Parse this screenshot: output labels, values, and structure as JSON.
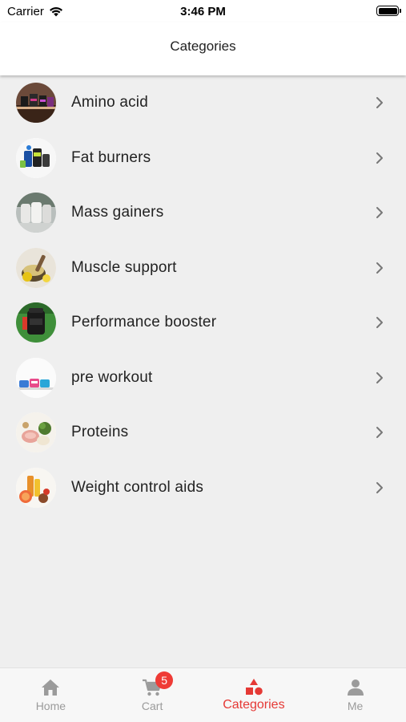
{
  "status_bar": {
    "carrier": "Carrier",
    "time": "3:46 PM"
  },
  "header": {
    "title": "Categories"
  },
  "categories": [
    {
      "label": "Amino acid",
      "thumb_icon": "amino-acid-thumbnail-icon"
    },
    {
      "label": "Fat burners",
      "thumb_icon": "fat-burners-thumbnail-icon"
    },
    {
      "label": "Mass gainers",
      "thumb_icon": "mass-gainers-thumbnail-icon"
    },
    {
      "label": "Muscle support",
      "thumb_icon": "muscle-support-thumbnail-icon"
    },
    {
      "label": "Performance booster",
      "thumb_icon": "performance-booster-thumbnail-icon"
    },
    {
      "label": "pre workout",
      "thumb_icon": "pre-workout-thumbnail-icon"
    },
    {
      "label": "Proteins",
      "thumb_icon": "proteins-thumbnail-icon"
    },
    {
      "label": "Weight control aids",
      "thumb_icon": "weight-control-thumbnail-icon"
    }
  ],
  "tabs": [
    {
      "label": "Home",
      "icon": "home-icon",
      "active": false
    },
    {
      "label": "Cart",
      "icon": "cart-icon",
      "active": false,
      "badge": "5"
    },
    {
      "label": "Categories",
      "icon": "categories-icon",
      "active": true
    },
    {
      "label": "Me",
      "icon": "person-icon",
      "active": false
    }
  ],
  "colors": {
    "accent": "#e53935",
    "badge": "#ef3b36",
    "inactive_tab": "#9b9b9b",
    "background": "#efefef"
  }
}
